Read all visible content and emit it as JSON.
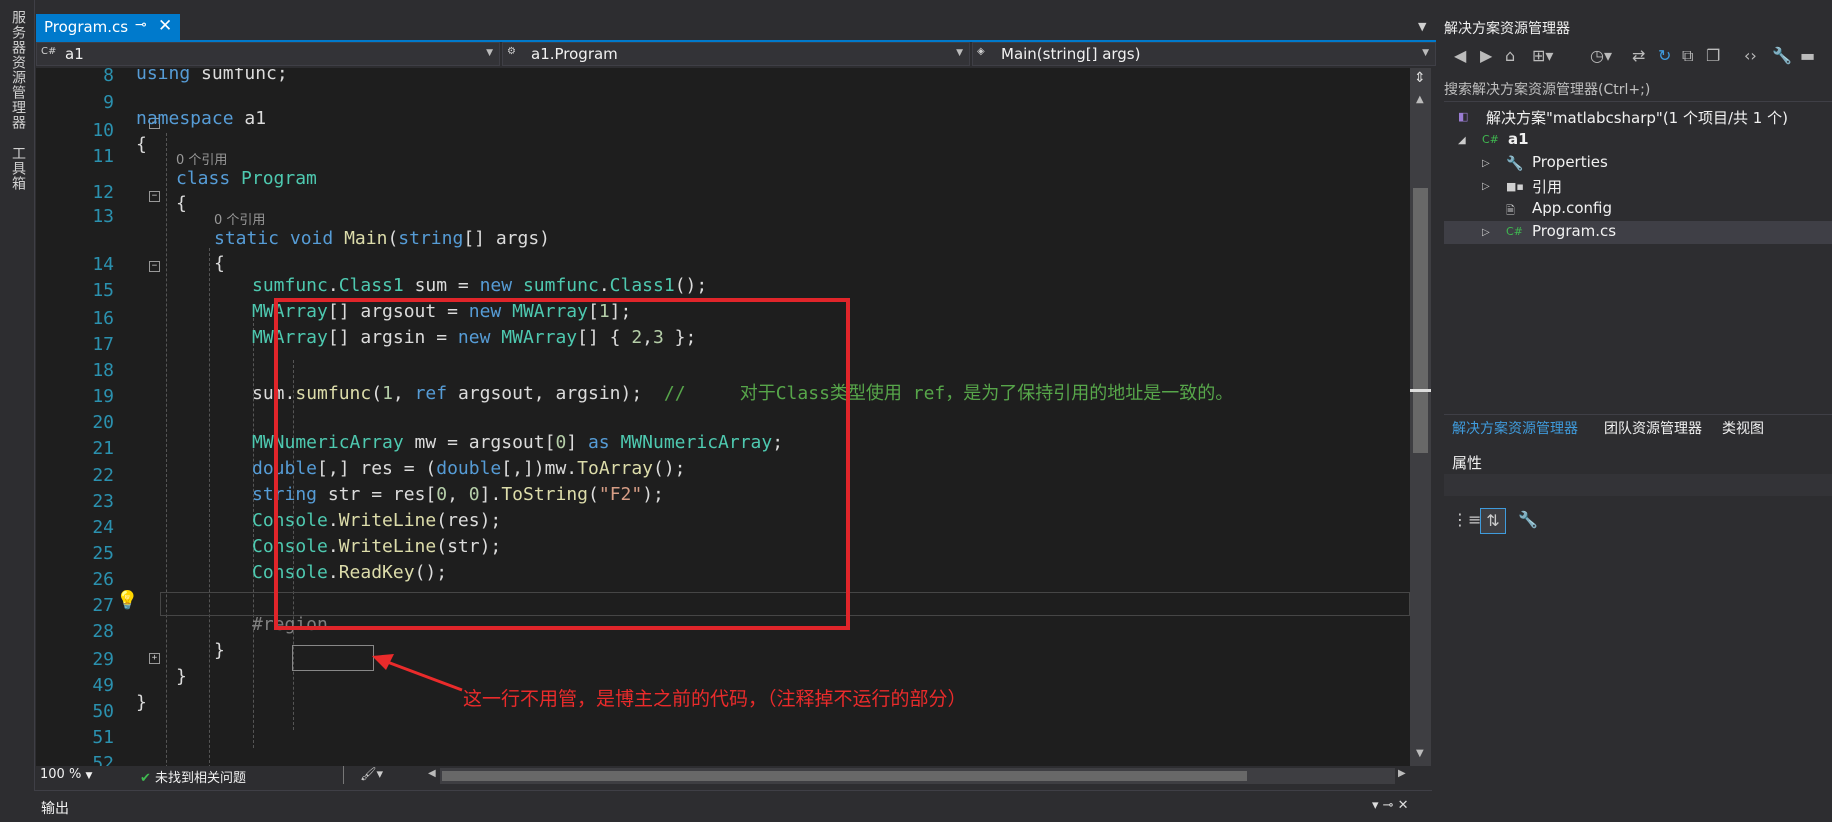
{
  "left_strip": {
    "tab1": "服务器资源管理器",
    "tab2": "工具箱"
  },
  "editor": {
    "tab": {
      "filename": "Program.cs",
      "pin": "⊸",
      "close": "✕"
    },
    "nav": {
      "project": "a1",
      "class": "a1.Program",
      "method": "Main(string[] args)"
    },
    "line_numbers": [
      "8",
      "9",
      "10",
      "11",
      "12",
      "13",
      "14",
      "15",
      "16",
      "17",
      "18",
      "19",
      "20",
      "21",
      "22",
      "23",
      "24",
      "25",
      "26",
      "27",
      "28",
      "29",
      "49",
      "50",
      "51",
      "52"
    ],
    "codelens": [
      "0 个引用",
      "0 个引用"
    ],
    "annotation": "这一行不用管，是博主之前的代码，（注释掉不运行的部分）",
    "zoom": "100 %",
    "issues": "未找到相关问题",
    "accent_red": "#e0252a"
  },
  "output": {
    "label": "输出"
  },
  "solution_explorer": {
    "title": "解决方案资源管理器",
    "search": "搜索解决方案资源管理器(Ctrl+;)",
    "solution": "解决方案\"matlabcsharp\"(1 个项目/共 1 个)",
    "project": "a1",
    "items": [
      "Properties",
      "引用",
      "App.config",
      "Program.cs"
    ],
    "tabs": [
      "解决方案资源管理器",
      "团队资源管理器",
      "类视图"
    ]
  },
  "properties": {
    "title": "属性"
  },
  "colors": {
    "accent": "#007acc",
    "editor_bg": "#1e1e1e"
  }
}
